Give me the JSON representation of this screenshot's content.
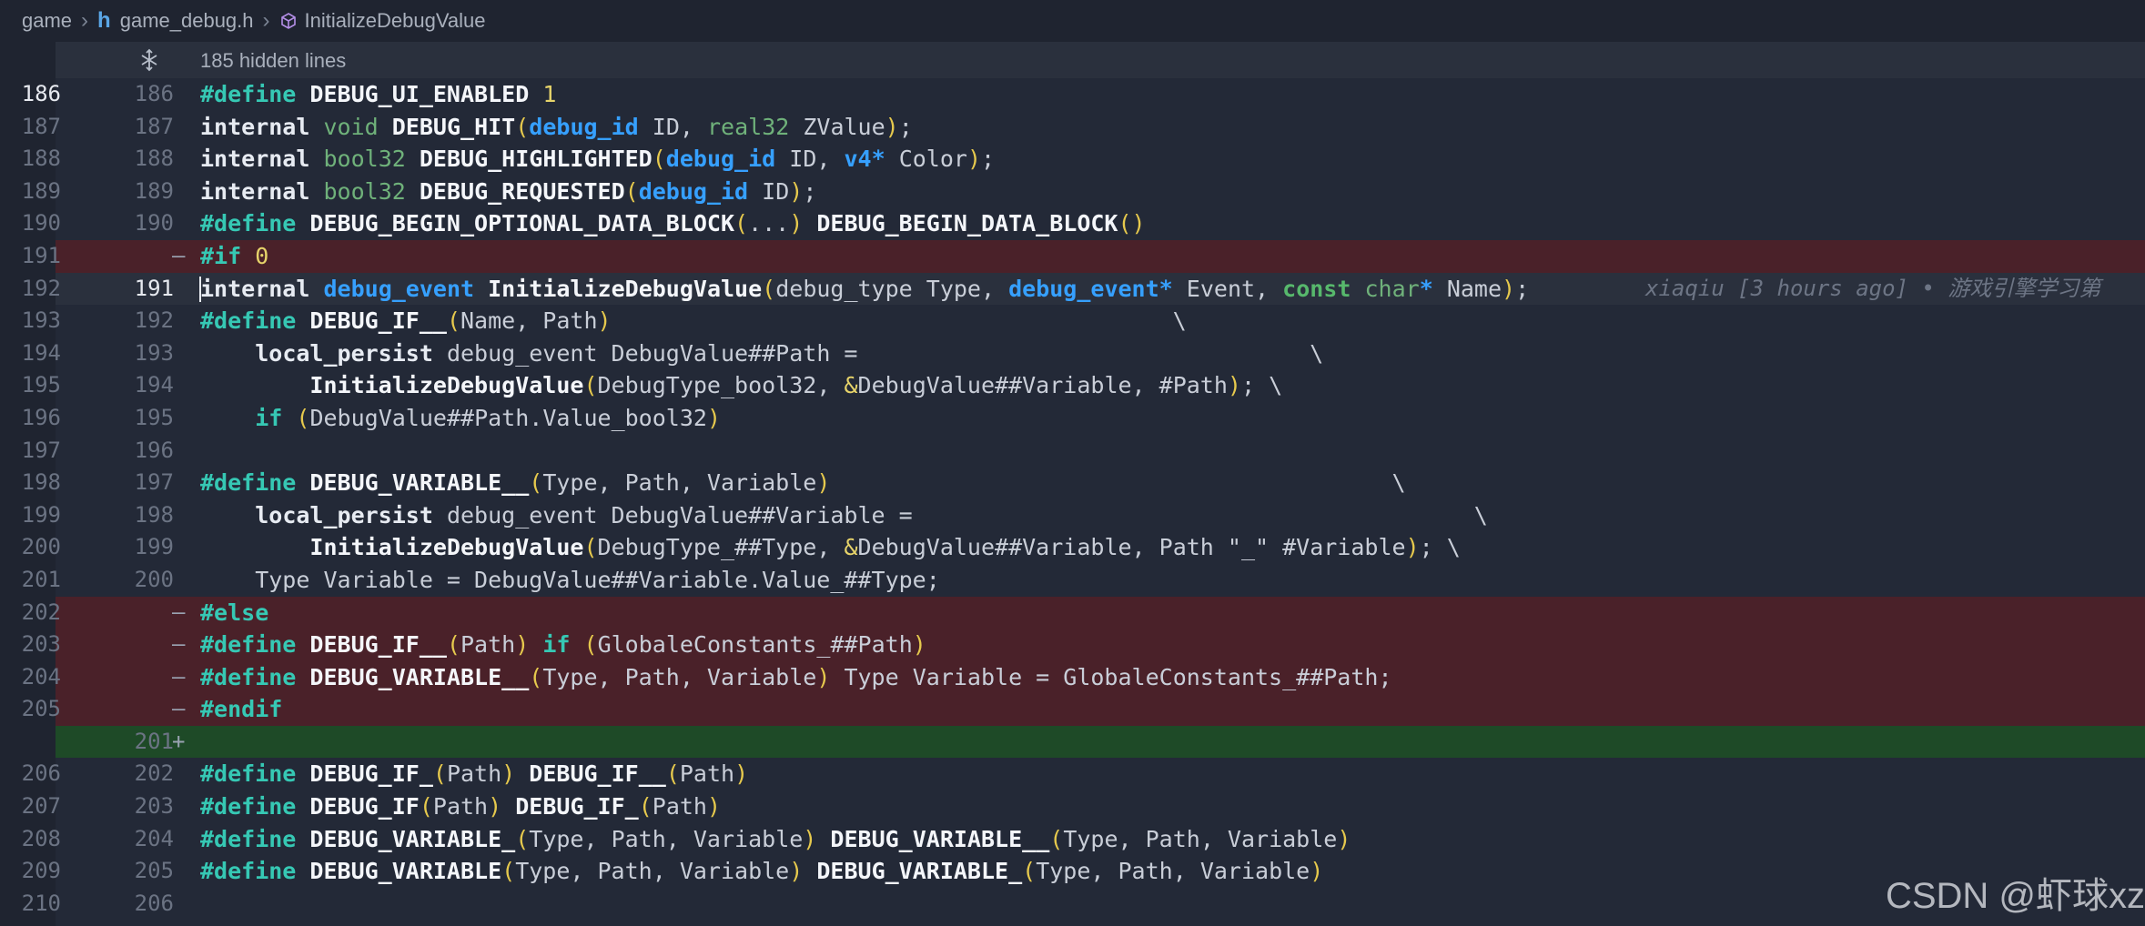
{
  "breadcrumb": {
    "items": [
      "game",
      "game_debug.h",
      "InitializeDebugValue"
    ]
  },
  "folded": {
    "label": "185 hidden lines"
  },
  "blame": "xiaqiu [3 hours ago] • 游戏引擎学习第",
  "lines": [
    {
      "old": "186",
      "new": "186",
      "marker": "",
      "type": "normal",
      "activeOld": true
    },
    {
      "old": "187",
      "new": "187",
      "marker": "",
      "type": "normal"
    },
    {
      "old": "188",
      "new": "188",
      "marker": "",
      "type": "normal"
    },
    {
      "old": "189",
      "new": "189",
      "marker": "",
      "type": "normal"
    },
    {
      "old": "190",
      "new": "190",
      "marker": "",
      "type": "normal"
    },
    {
      "old": "191",
      "new": "",
      "marker": "—",
      "type": "removed"
    },
    {
      "old": "192",
      "new": "191",
      "marker": "",
      "type": "current"
    },
    {
      "old": "193",
      "new": "192",
      "marker": "",
      "type": "normal"
    },
    {
      "old": "194",
      "new": "193",
      "marker": "",
      "type": "normal"
    },
    {
      "old": "195",
      "new": "194",
      "marker": "",
      "type": "normal"
    },
    {
      "old": "196",
      "new": "195",
      "marker": "",
      "type": "normal"
    },
    {
      "old": "197",
      "new": "196",
      "marker": "",
      "type": "normal"
    },
    {
      "old": "198",
      "new": "197",
      "marker": "",
      "type": "normal"
    },
    {
      "old": "199",
      "new": "198",
      "marker": "",
      "type": "normal"
    },
    {
      "old": "200",
      "new": "199",
      "marker": "",
      "type": "normal"
    },
    {
      "old": "201",
      "new": "200",
      "marker": "",
      "type": "normal"
    },
    {
      "old": "202",
      "new": "",
      "marker": "—",
      "type": "removed"
    },
    {
      "old": "203",
      "new": "",
      "marker": "—",
      "type": "removed"
    },
    {
      "old": "204",
      "new": "",
      "marker": "—",
      "type": "removed"
    },
    {
      "old": "205",
      "new": "",
      "marker": "—",
      "type": "removed"
    },
    {
      "old": "",
      "new": "201",
      "marker": "+",
      "type": "added"
    },
    {
      "old": "206",
      "new": "202",
      "marker": "",
      "type": "normal"
    },
    {
      "old": "207",
      "new": "203",
      "marker": "",
      "type": "normal"
    },
    {
      "old": "208",
      "new": "204",
      "marker": "",
      "type": "normal"
    },
    {
      "old": "209",
      "new": "205",
      "marker": "",
      "type": "normal"
    },
    {
      "old": "210",
      "new": "206",
      "marker": "",
      "type": "normal"
    }
  ],
  "code": [
    [
      [
        "pp",
        "#define"
      ],
      [
        "",
        " "
      ],
      [
        "fn",
        "DEBUG_UI_ENABLED"
      ],
      [
        "",
        " "
      ],
      [
        "num",
        "1"
      ]
    ],
    [
      [
        "kw",
        "internal"
      ],
      [
        "",
        " "
      ],
      [
        "tyg",
        "void"
      ],
      [
        "",
        " "
      ],
      [
        "fn",
        "DEBUG_HIT"
      ],
      [
        "paren",
        "("
      ],
      [
        "ty",
        "debug_id"
      ],
      [
        "",
        " ID, "
      ],
      [
        "tyg",
        "real32"
      ],
      [
        "",
        " ZValue"
      ],
      [
        "paren",
        ")"
      ],
      [
        "",
        ";"
      ]
    ],
    [
      [
        "kw",
        "internal"
      ],
      [
        "",
        " "
      ],
      [
        "tyg",
        "bool32"
      ],
      [
        "",
        " "
      ],
      [
        "fn",
        "DEBUG_HIGHLIGHTED"
      ],
      [
        "paren",
        "("
      ],
      [
        "ty",
        "debug_id"
      ],
      [
        "",
        " ID, "
      ],
      [
        "ty",
        "v4*"
      ],
      [
        "",
        " Color"
      ],
      [
        "paren",
        ")"
      ],
      [
        "",
        ";"
      ]
    ],
    [
      [
        "kw",
        "internal"
      ],
      [
        "",
        " "
      ],
      [
        "tyg",
        "bool32"
      ],
      [
        "",
        " "
      ],
      [
        "fn",
        "DEBUG_REQUESTED"
      ],
      [
        "paren",
        "("
      ],
      [
        "ty",
        "debug_id"
      ],
      [
        "",
        " ID"
      ],
      [
        "paren",
        ")"
      ],
      [
        "",
        ";"
      ]
    ],
    [
      [
        "pp",
        "#define"
      ],
      [
        "",
        " "
      ],
      [
        "fn",
        "DEBUG_BEGIN_OPTIONAL_DATA_BLOCK"
      ],
      [
        "paren",
        "("
      ],
      [
        "",
        "..."
      ],
      [
        "paren",
        ")"
      ],
      [
        "",
        " "
      ],
      [
        "fn",
        "DEBUG_BEGIN_DATA_BLOCK"
      ],
      [
        "paren",
        "()"
      ]
    ],
    [
      [
        "pp",
        "#if"
      ],
      [
        "",
        " "
      ],
      [
        "num",
        "0"
      ]
    ],
    [
      [
        "kw",
        "internal"
      ],
      [
        "",
        " "
      ],
      [
        "ty",
        "debug_event"
      ],
      [
        "",
        " "
      ],
      [
        "fn",
        "InitializeDebugValue"
      ],
      [
        "paren",
        "("
      ],
      [
        "",
        "debug_type Type, "
      ],
      [
        "ty",
        "debug_event"
      ],
      [
        "ty",
        "*"
      ],
      [
        "",
        " Event, "
      ],
      [
        "cons",
        "const"
      ],
      [
        "",
        " "
      ],
      [
        "tyg",
        "char"
      ],
      [
        "ty",
        "*"
      ],
      [
        "",
        " Name"
      ],
      [
        "paren",
        ")"
      ],
      [
        "",
        ";"
      ]
    ],
    [
      [
        "pp",
        "#define"
      ],
      [
        "",
        " "
      ],
      [
        "fn",
        "DEBUG_IF__"
      ],
      [
        "paren",
        "("
      ],
      [
        "",
        "Name, Path"
      ],
      [
        "paren",
        ")"
      ],
      [
        "",
        "                                         \\"
      ]
    ],
    [
      [
        "",
        "    "
      ],
      [
        "kw",
        "local_persist"
      ],
      [
        "",
        " debug_event DebugValue##Path =                                 \\"
      ]
    ],
    [
      [
        "",
        "        "
      ],
      [
        "fn",
        "InitializeDebugValue"
      ],
      [
        "paren",
        "("
      ],
      [
        "",
        "DebugType_bool32, "
      ],
      [
        "num",
        "&"
      ],
      [
        "",
        "DebugValue##Variable, #Path"
      ],
      [
        "paren",
        ")"
      ],
      [
        "",
        "; \\"
      ]
    ],
    [
      [
        "",
        "    "
      ],
      [
        "pp",
        "if"
      ],
      [
        "",
        " "
      ],
      [
        "paren",
        "("
      ],
      [
        "",
        "DebugValue##Path.Value_bool32"
      ],
      [
        "paren",
        ")"
      ]
    ],
    [
      [
        "",
        ""
      ]
    ],
    [
      [
        "pp",
        "#define"
      ],
      [
        "",
        " "
      ],
      [
        "fn",
        "DEBUG_VARIABLE__"
      ],
      [
        "paren",
        "("
      ],
      [
        "",
        "Type, Path, Variable"
      ],
      [
        "paren",
        ")"
      ],
      [
        "",
        "                                         \\"
      ]
    ],
    [
      [
        "",
        "    "
      ],
      [
        "kw",
        "local_persist"
      ],
      [
        "",
        " debug_event DebugValue##Variable =                                         \\"
      ]
    ],
    [
      [
        "",
        "        "
      ],
      [
        "fn",
        "InitializeDebugValue"
      ],
      [
        "paren",
        "("
      ],
      [
        "",
        "DebugType_##Type, "
      ],
      [
        "num",
        "&"
      ],
      [
        "",
        "DebugValue##Variable, Path \"_\" #Variable"
      ],
      [
        "paren",
        ")"
      ],
      [
        "",
        "; \\"
      ]
    ],
    [
      [
        "",
        "    Type Variable = DebugValue##Variable.Value_##Type;"
      ]
    ],
    [
      [
        "pp",
        "#else"
      ]
    ],
    [
      [
        "pp",
        "#define"
      ],
      [
        "",
        " "
      ],
      [
        "fn",
        "DEBUG_IF__"
      ],
      [
        "paren",
        "("
      ],
      [
        "",
        "Path"
      ],
      [
        "paren",
        ")"
      ],
      [
        "",
        " "
      ],
      [
        "pp",
        "if"
      ],
      [
        "",
        " "
      ],
      [
        "paren",
        "("
      ],
      [
        "",
        "GlobaleConstants_##Path"
      ],
      [
        "paren",
        ")"
      ]
    ],
    [
      [
        "pp",
        "#define"
      ],
      [
        "",
        " "
      ],
      [
        "fn",
        "DEBUG_VARIABLE__"
      ],
      [
        "paren",
        "("
      ],
      [
        "",
        "Type, Path, Variable"
      ],
      [
        "paren",
        ")"
      ],
      [
        "",
        " Type Variable = GlobaleConstants_##Path;"
      ]
    ],
    [
      [
        "pp",
        "#endif"
      ]
    ],
    [
      [
        "",
        ""
      ]
    ],
    [
      [
        "pp",
        "#define"
      ],
      [
        "",
        " "
      ],
      [
        "fn",
        "DEBUG_IF_"
      ],
      [
        "paren",
        "("
      ],
      [
        "",
        "Path"
      ],
      [
        "paren",
        ")"
      ],
      [
        "",
        " "
      ],
      [
        "fn",
        "DEBUG_IF__"
      ],
      [
        "paren",
        "("
      ],
      [
        "",
        "Path"
      ],
      [
        "paren",
        ")"
      ]
    ],
    [
      [
        "pp",
        "#define"
      ],
      [
        "",
        " "
      ],
      [
        "fn",
        "DEBUG_IF"
      ],
      [
        "paren",
        "("
      ],
      [
        "",
        "Path"
      ],
      [
        "paren",
        ")"
      ],
      [
        "",
        " "
      ],
      [
        "fn",
        "DEBUG_IF_"
      ],
      [
        "paren",
        "("
      ],
      [
        "",
        "Path"
      ],
      [
        "paren",
        ")"
      ]
    ],
    [
      [
        "pp",
        "#define"
      ],
      [
        "",
        " "
      ],
      [
        "fn",
        "DEBUG_VARIABLE_"
      ],
      [
        "paren",
        "("
      ],
      [
        "",
        "Type, Path, Variable"
      ],
      [
        "paren",
        ")"
      ],
      [
        "",
        " "
      ],
      [
        "fn",
        "DEBUG_VARIABLE__"
      ],
      [
        "paren",
        "("
      ],
      [
        "",
        "Type, Path, Variable"
      ],
      [
        "paren",
        ")"
      ]
    ],
    [
      [
        "pp",
        "#define"
      ],
      [
        "",
        " "
      ],
      [
        "fn",
        "DEBUG_VARIABLE"
      ],
      [
        "paren",
        "("
      ],
      [
        "",
        "Type, Path, Variable"
      ],
      [
        "paren",
        ")"
      ],
      [
        "",
        " "
      ],
      [
        "fn",
        "DEBUG_VARIABLE_"
      ],
      [
        "paren",
        "("
      ],
      [
        "",
        "Type, Path, Variable"
      ],
      [
        "paren",
        ")"
      ]
    ],
    [
      [
        "",
        ""
      ]
    ]
  ],
  "watermark": "CSDN @虾球xz",
  "colors": {
    "removed": "#4a2129",
    "added": "#1e4a27",
    "preprocessor": "#36c8b4",
    "type": "#36a0ff"
  }
}
